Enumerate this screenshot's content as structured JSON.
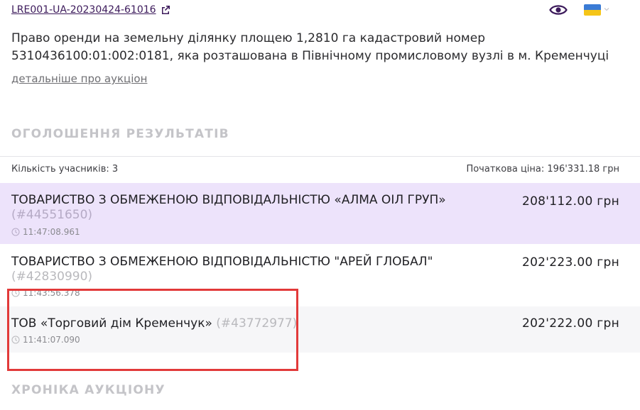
{
  "header": {
    "auction_id": "LRE001-UA-20230424-61016",
    "icons": [
      "external-link-icon",
      "eye-icon",
      "ukraine-flag-icon",
      "chevron-down-icon"
    ]
  },
  "description": "Право оренди на земельну ділянку площею 1,2810 га кадастровий номер 5310436100:01:002:0181, яка розташована в Північному промисловому вузлі в м. Кременчуці",
  "details_link": "детальніше про аукціон",
  "results": {
    "title": "ОГОЛОШЕННЯ РЕЗУЛЬТАТІВ",
    "participants_label": "Кількість учасників:",
    "participants_count": "3",
    "start_price_label": "Початкова ціна:",
    "start_price": "196'331.18 грн",
    "bids": [
      {
        "name": "ТОВАРИСТВО З ОБМЕЖЕНОЮ ВІДПОВІДАЛЬНІСТЮ «АЛМА ОІЛ ГРУП»",
        "id": "(#44551650)",
        "amount": "208'112.00 грн",
        "time": "11:47:08.961"
      },
      {
        "name": "ТОВАРИСТВО З ОБМЕЖЕНОЮ ВІДПОВІДАЛЬНІСТЮ \"АРЕЙ ГЛОБАЛ\"",
        "id": "(#42830990)",
        "amount": "202'223.00 грн",
        "time": "11:43:56.378"
      },
      {
        "name": "ТОВ «Торговий дім Кременчук»",
        "id": "(#43772977)",
        "amount": "202'222.00 грн",
        "time": "11:41:07.090"
      }
    ]
  },
  "chronicle": {
    "title": "ХРОНІКА АУКЦІОНУ"
  },
  "colors": {
    "link": "#3c1a5b",
    "winner_bg": "#ede3fb",
    "annotation": "#e23a3a",
    "section_title": "#c4c4c8"
  }
}
